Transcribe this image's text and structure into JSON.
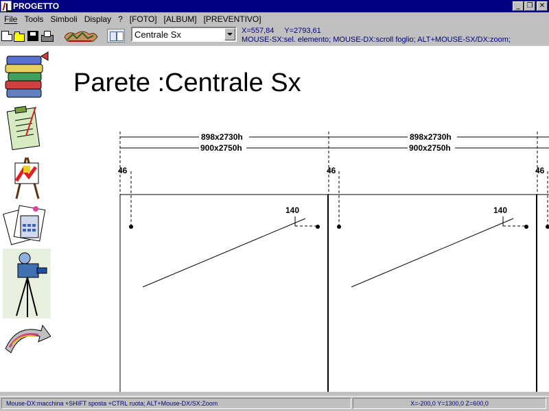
{
  "window": {
    "title": "PROGETTO",
    "minimize_glyph": "_",
    "restore_glyph": "❐",
    "close_glyph": "✕"
  },
  "menu": {
    "items": [
      "File",
      "Tools",
      "Simboli",
      "Display",
      "?",
      "[FOTO]",
      "[ALBUM]",
      "[PREVENTIVO]"
    ]
  },
  "toolbar": {
    "icons": [
      "new-document-icon",
      "open-folder-icon",
      "save-disk-icon",
      "print-icon",
      "logo-icon",
      "view-mode-icon"
    ],
    "combo_value": "Centrale Sx",
    "coord_x": "X=557,84",
    "coord_y": "Y=2793,61",
    "hint": "MOUSE-SX:sel. elemento; MOUSE-DX:scroll foglio; ALT+MOUSE-SX/DX:zoom;"
  },
  "sidebar": {
    "icons": [
      "books-icon",
      "clipboard-checklist-icon",
      "easel-painting-icon",
      "calculator-documents-icon",
      "camera-tripod-icon",
      "arrow-banner-icon"
    ]
  },
  "drawing": {
    "title": "Parete :Centrale Sx",
    "panels": [
      {
        "dim_inner": "898x2730h",
        "dim_outer": "900x2750h",
        "left_offset": "46",
        "mark": "140"
      },
      {
        "dim_inner": "898x2730h",
        "dim_outer": "900x2750h",
        "left_offset": "46",
        "mark": "140"
      }
    ],
    "right_offset": "46"
  },
  "statusbar": {
    "left": "Mouse-DX:macchina +SHIFT sposta +CTRL ruota; ALT+Mouse-DX/SX:Zoom",
    "right": "X=-200,0 Y=1300,0 Z=600,0"
  },
  "colors": {
    "titlebar": "#000080",
    "face": "#c0c0c0",
    "info_text": "#000080",
    "canvas": "#ffffff"
  }
}
